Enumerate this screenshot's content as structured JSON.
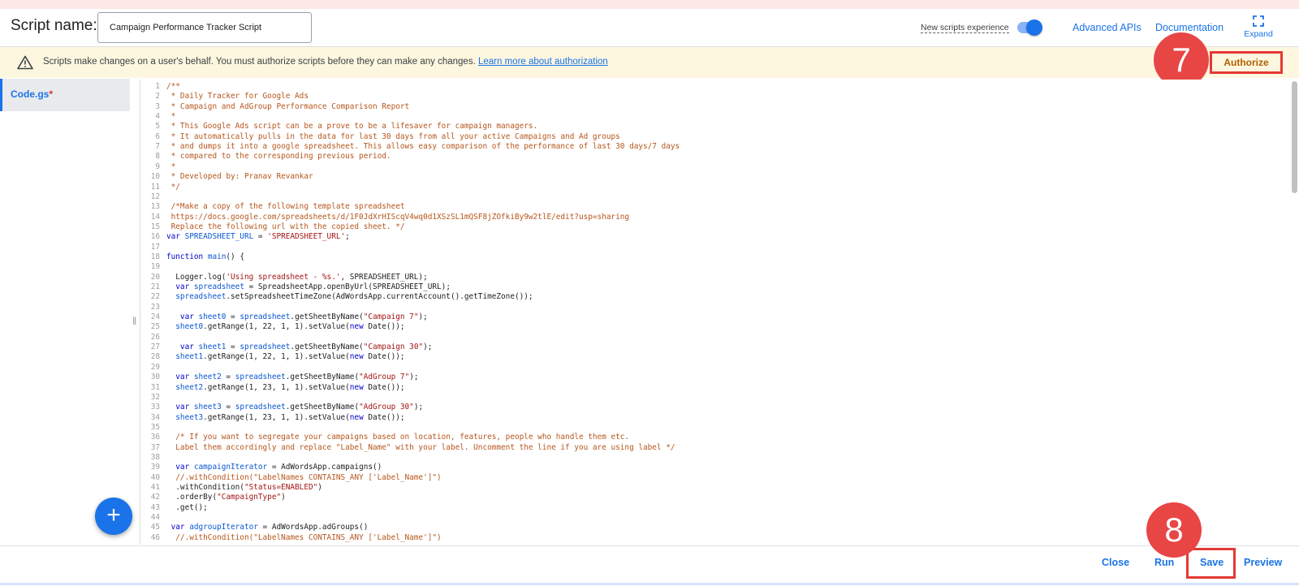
{
  "header": {
    "script_name_label": "Script name:",
    "script_name_value": "Campaign Performance Tracker Script",
    "new_scripts_label": "New scripts experience",
    "new_scripts_enabled": true,
    "advanced_apis": "Advanced APIs",
    "documentation": "Documentation",
    "expand": "Expand"
  },
  "banner": {
    "text": "Scripts make changes on a user's behalf. You must authorize scripts before they can make any changes.",
    "link": "Learn more about authorization",
    "authorize": "Authorize"
  },
  "annotations": {
    "step7": "7",
    "step8": "8"
  },
  "sidebar": {
    "file": "Code.gs",
    "modified_marker": "*",
    "add_icon": "plus-icon"
  },
  "footer": {
    "close": "Close",
    "run": "Run",
    "save": "Save",
    "preview": "Preview"
  },
  "colors": {
    "accent": "#1a73e8",
    "annotation": "#e84545",
    "banner_bg": "#fef7e0"
  },
  "code": [
    {
      "n": "1",
      "segs": [
        [
          "c",
          "/**"
        ]
      ]
    },
    {
      "n": "2",
      "segs": [
        [
          "c",
          " * Daily Tracker for Google Ads"
        ]
      ]
    },
    {
      "n": "3",
      "segs": [
        [
          "c",
          " * Campaign and AdGroup Performance Comparison Report"
        ]
      ]
    },
    {
      "n": "4",
      "segs": [
        [
          "c",
          " *"
        ]
      ]
    },
    {
      "n": "5",
      "segs": [
        [
          "c",
          " * This Google Ads script can be a prove to be a lifesaver for campaign managers."
        ]
      ]
    },
    {
      "n": "6",
      "segs": [
        [
          "c",
          " * It automatically pulls in the data for last 30 days from all your active Campaigns and Ad groups"
        ]
      ]
    },
    {
      "n": "7",
      "segs": [
        [
          "c",
          " * and dumps it into a google spreadsheet. This allows easy comparison of the performance of last 30 days/7 days"
        ]
      ]
    },
    {
      "n": "8",
      "segs": [
        [
          "c",
          " * compared to the corresponding previous period."
        ]
      ]
    },
    {
      "n": "9",
      "segs": [
        [
          "c",
          " *"
        ]
      ]
    },
    {
      "n": "10",
      "segs": [
        [
          "c",
          " * Developed by: Pranav Revankar"
        ]
      ]
    },
    {
      "n": "11",
      "segs": [
        [
          "c",
          " */"
        ]
      ]
    },
    {
      "n": "12",
      "segs": []
    },
    {
      "n": "13",
      "segs": [
        [
          "c",
          " /*Make a copy of the following template spreadsheet"
        ]
      ]
    },
    {
      "n": "14",
      "segs": [
        [
          "c",
          " https://docs.google.com/spreadsheets/d/1F0JdXrHIScqV4wq0d1XSzSL1mQSF8jZOfkiBy9w2tlE/edit?usp=sharing"
        ]
      ]
    },
    {
      "n": "15",
      "segs": [
        [
          "c",
          " Replace the following url with the copied sheet. */"
        ]
      ]
    },
    {
      "n": "16",
      "segs": [
        [
          "k",
          "var "
        ],
        [
          "v",
          "SPREADSHEET_URL"
        ],
        [
          "t",
          " = "
        ],
        [
          "s",
          "'SPREADSHEET_URL'"
        ],
        [
          "t",
          ";"
        ]
      ]
    },
    {
      "n": "17",
      "segs": []
    },
    {
      "n": "18",
      "segs": [
        [
          "k",
          "function "
        ],
        [
          "v",
          "main"
        ],
        [
          "t",
          "() {"
        ]
      ]
    },
    {
      "n": "19",
      "segs": []
    },
    {
      "n": "20",
      "segs": [
        [
          "t",
          "  Logger.log("
        ],
        [
          "s",
          "'Using spreadsheet - %s.'"
        ],
        [
          "t",
          ", SPREADSHEET_URL);"
        ]
      ]
    },
    {
      "n": "21",
      "segs": [
        [
          "k",
          "  var "
        ],
        [
          "v",
          "spreadsheet"
        ],
        [
          "t",
          " = SpreadsheetApp.openByUrl(SPREADSHEET_URL);"
        ]
      ]
    },
    {
      "n": "22",
      "segs": [
        [
          "v",
          "  spreadsheet"
        ],
        [
          "t",
          ".setSpreadsheetTimeZone(AdWordsApp.currentAccount().getTimeZone());"
        ]
      ]
    },
    {
      "n": "23",
      "segs": []
    },
    {
      "n": "24",
      "segs": [
        [
          "k",
          "   var "
        ],
        [
          "v",
          "sheet0"
        ],
        [
          "t",
          " = "
        ],
        [
          "v",
          "spreadsheet"
        ],
        [
          "t",
          ".getSheetByName("
        ],
        [
          "s",
          "\"Campaign 7\""
        ],
        [
          "t",
          ");"
        ]
      ]
    },
    {
      "n": "25",
      "segs": [
        [
          "v",
          "  sheet0"
        ],
        [
          "t",
          ".getRange(1, 22, 1, 1).setValue("
        ],
        [
          "k",
          "new "
        ],
        [
          "t",
          "Date());"
        ]
      ]
    },
    {
      "n": "26",
      "segs": []
    },
    {
      "n": "27",
      "segs": [
        [
          "k",
          "   var "
        ],
        [
          "v",
          "sheet1"
        ],
        [
          "t",
          " = "
        ],
        [
          "v",
          "spreadsheet"
        ],
        [
          "t",
          ".getSheetByName("
        ],
        [
          "s",
          "\"Campaign 30\""
        ],
        [
          "t",
          ");"
        ]
      ]
    },
    {
      "n": "28",
      "segs": [
        [
          "v",
          "  sheet1"
        ],
        [
          "t",
          ".getRange(1, 22, 1, 1).setValue("
        ],
        [
          "k",
          "new "
        ],
        [
          "t",
          "Date());"
        ]
      ]
    },
    {
      "n": "29",
      "segs": []
    },
    {
      "n": "30",
      "segs": [
        [
          "k",
          "  var "
        ],
        [
          "v",
          "sheet2"
        ],
        [
          "t",
          " = "
        ],
        [
          "v",
          "spreadsheet"
        ],
        [
          "t",
          ".getSheetByName("
        ],
        [
          "s",
          "\"AdGroup 7\""
        ],
        [
          "t",
          ");"
        ]
      ]
    },
    {
      "n": "31",
      "segs": [
        [
          "v",
          "  sheet2"
        ],
        [
          "t",
          ".getRange(1, 23, 1, 1).setValue("
        ],
        [
          "k",
          "new "
        ],
        [
          "t",
          "Date());"
        ]
      ]
    },
    {
      "n": "32",
      "segs": []
    },
    {
      "n": "33",
      "segs": [
        [
          "k",
          "  var "
        ],
        [
          "v",
          "sheet3"
        ],
        [
          "t",
          " = "
        ],
        [
          "v",
          "spreadsheet"
        ],
        [
          "t",
          ".getSheetByName("
        ],
        [
          "s",
          "\"AdGroup 30\""
        ],
        [
          "t",
          ");"
        ]
      ]
    },
    {
      "n": "34",
      "segs": [
        [
          "v",
          "  sheet3"
        ],
        [
          "t",
          ".getRange(1, 23, 1, 1).setValue("
        ],
        [
          "k",
          "new "
        ],
        [
          "t",
          "Date());"
        ]
      ]
    },
    {
      "n": "35",
      "segs": []
    },
    {
      "n": "36",
      "segs": [
        [
          "c",
          "  /* If you want to segregate your campaigns based on location, features, people who handle them etc."
        ]
      ]
    },
    {
      "n": "37",
      "segs": [
        [
          "c",
          "  Label them accordingly and replace \"Label_Name\" with your label. Uncomment the line if you are using label */"
        ]
      ]
    },
    {
      "n": "38",
      "segs": []
    },
    {
      "n": "39",
      "segs": [
        [
          "k",
          "  var "
        ],
        [
          "v",
          "campaignIterator"
        ],
        [
          "t",
          " = AdWordsApp.campaigns()"
        ]
      ]
    },
    {
      "n": "40",
      "segs": [
        [
          "c",
          "  //.withCondition(\"LabelNames CONTAINS_ANY ['Label_Name']\")"
        ]
      ]
    },
    {
      "n": "41",
      "segs": [
        [
          "t",
          "  .withCondition("
        ],
        [
          "s",
          "\"Status=ENABLED\""
        ],
        [
          "t",
          ")"
        ]
      ]
    },
    {
      "n": "42",
      "segs": [
        [
          "t",
          "  .orderBy("
        ],
        [
          "s",
          "\"CampaignType\""
        ],
        [
          "t",
          ")"
        ]
      ]
    },
    {
      "n": "43",
      "segs": [
        [
          "t",
          "  .get();"
        ]
      ]
    },
    {
      "n": "44",
      "segs": []
    },
    {
      "n": "45",
      "segs": [
        [
          "k",
          " var "
        ],
        [
          "v",
          "adgroupIterator"
        ],
        [
          "t",
          " = AdWordsApp.adGroups()"
        ]
      ]
    },
    {
      "n": "46",
      "segs": [
        [
          "c",
          "  //.withCondition(\"LabelNames CONTAINS_ANY ['Label_Name']\")"
        ]
      ]
    }
  ]
}
